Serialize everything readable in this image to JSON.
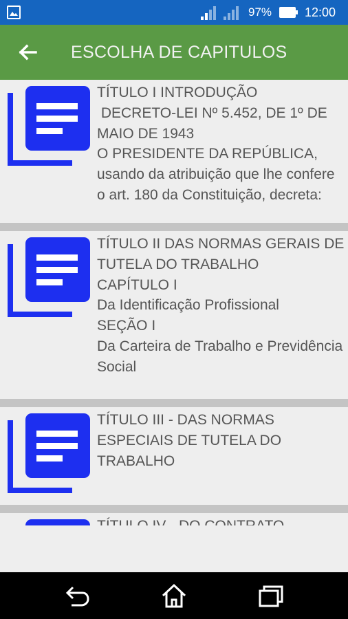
{
  "status_bar": {
    "battery_percent": "97%",
    "time": "12:00",
    "icons": [
      "gallery-icon",
      "wifi-icon",
      "signal-icon",
      "battery-icon"
    ]
  },
  "app_bar": {
    "title": "ESCOLHA DE CAPITULOS",
    "back_icon": "arrow-left-icon",
    "color": "#5a9a45"
  },
  "items": [
    {
      "text": "TÍTULO I INTRODUÇÃO\n DECRETO-LEI Nº 5.452, DE 1º DE MAIO DE 1943\nO PRESIDENTE DA REPÚBLICA, usando da atribuição que lhe confere o art. 180 da Constituição, decreta:"
    },
    {
      "text": "TÍTULO II DAS NORMAS GERAIS DE TUTELA DO TRABALHO\nCAPÍTULO I\nDa Identificação Profissional\nSEÇÃO I\nDa Carteira de Trabalho e Previdência Social"
    },
    {
      "text": "TÍTULO III - DAS NORMAS ESPECIAIS DE TUTELA DO TRABALHO"
    },
    {
      "text": "TÍTULO IV - DO CONTRATO"
    }
  ],
  "item_icon": "document-list-icon",
  "icon_color": "#1d2ff0",
  "nav_bar": {
    "icons": [
      "back-icon",
      "home-icon",
      "recents-icon"
    ]
  }
}
